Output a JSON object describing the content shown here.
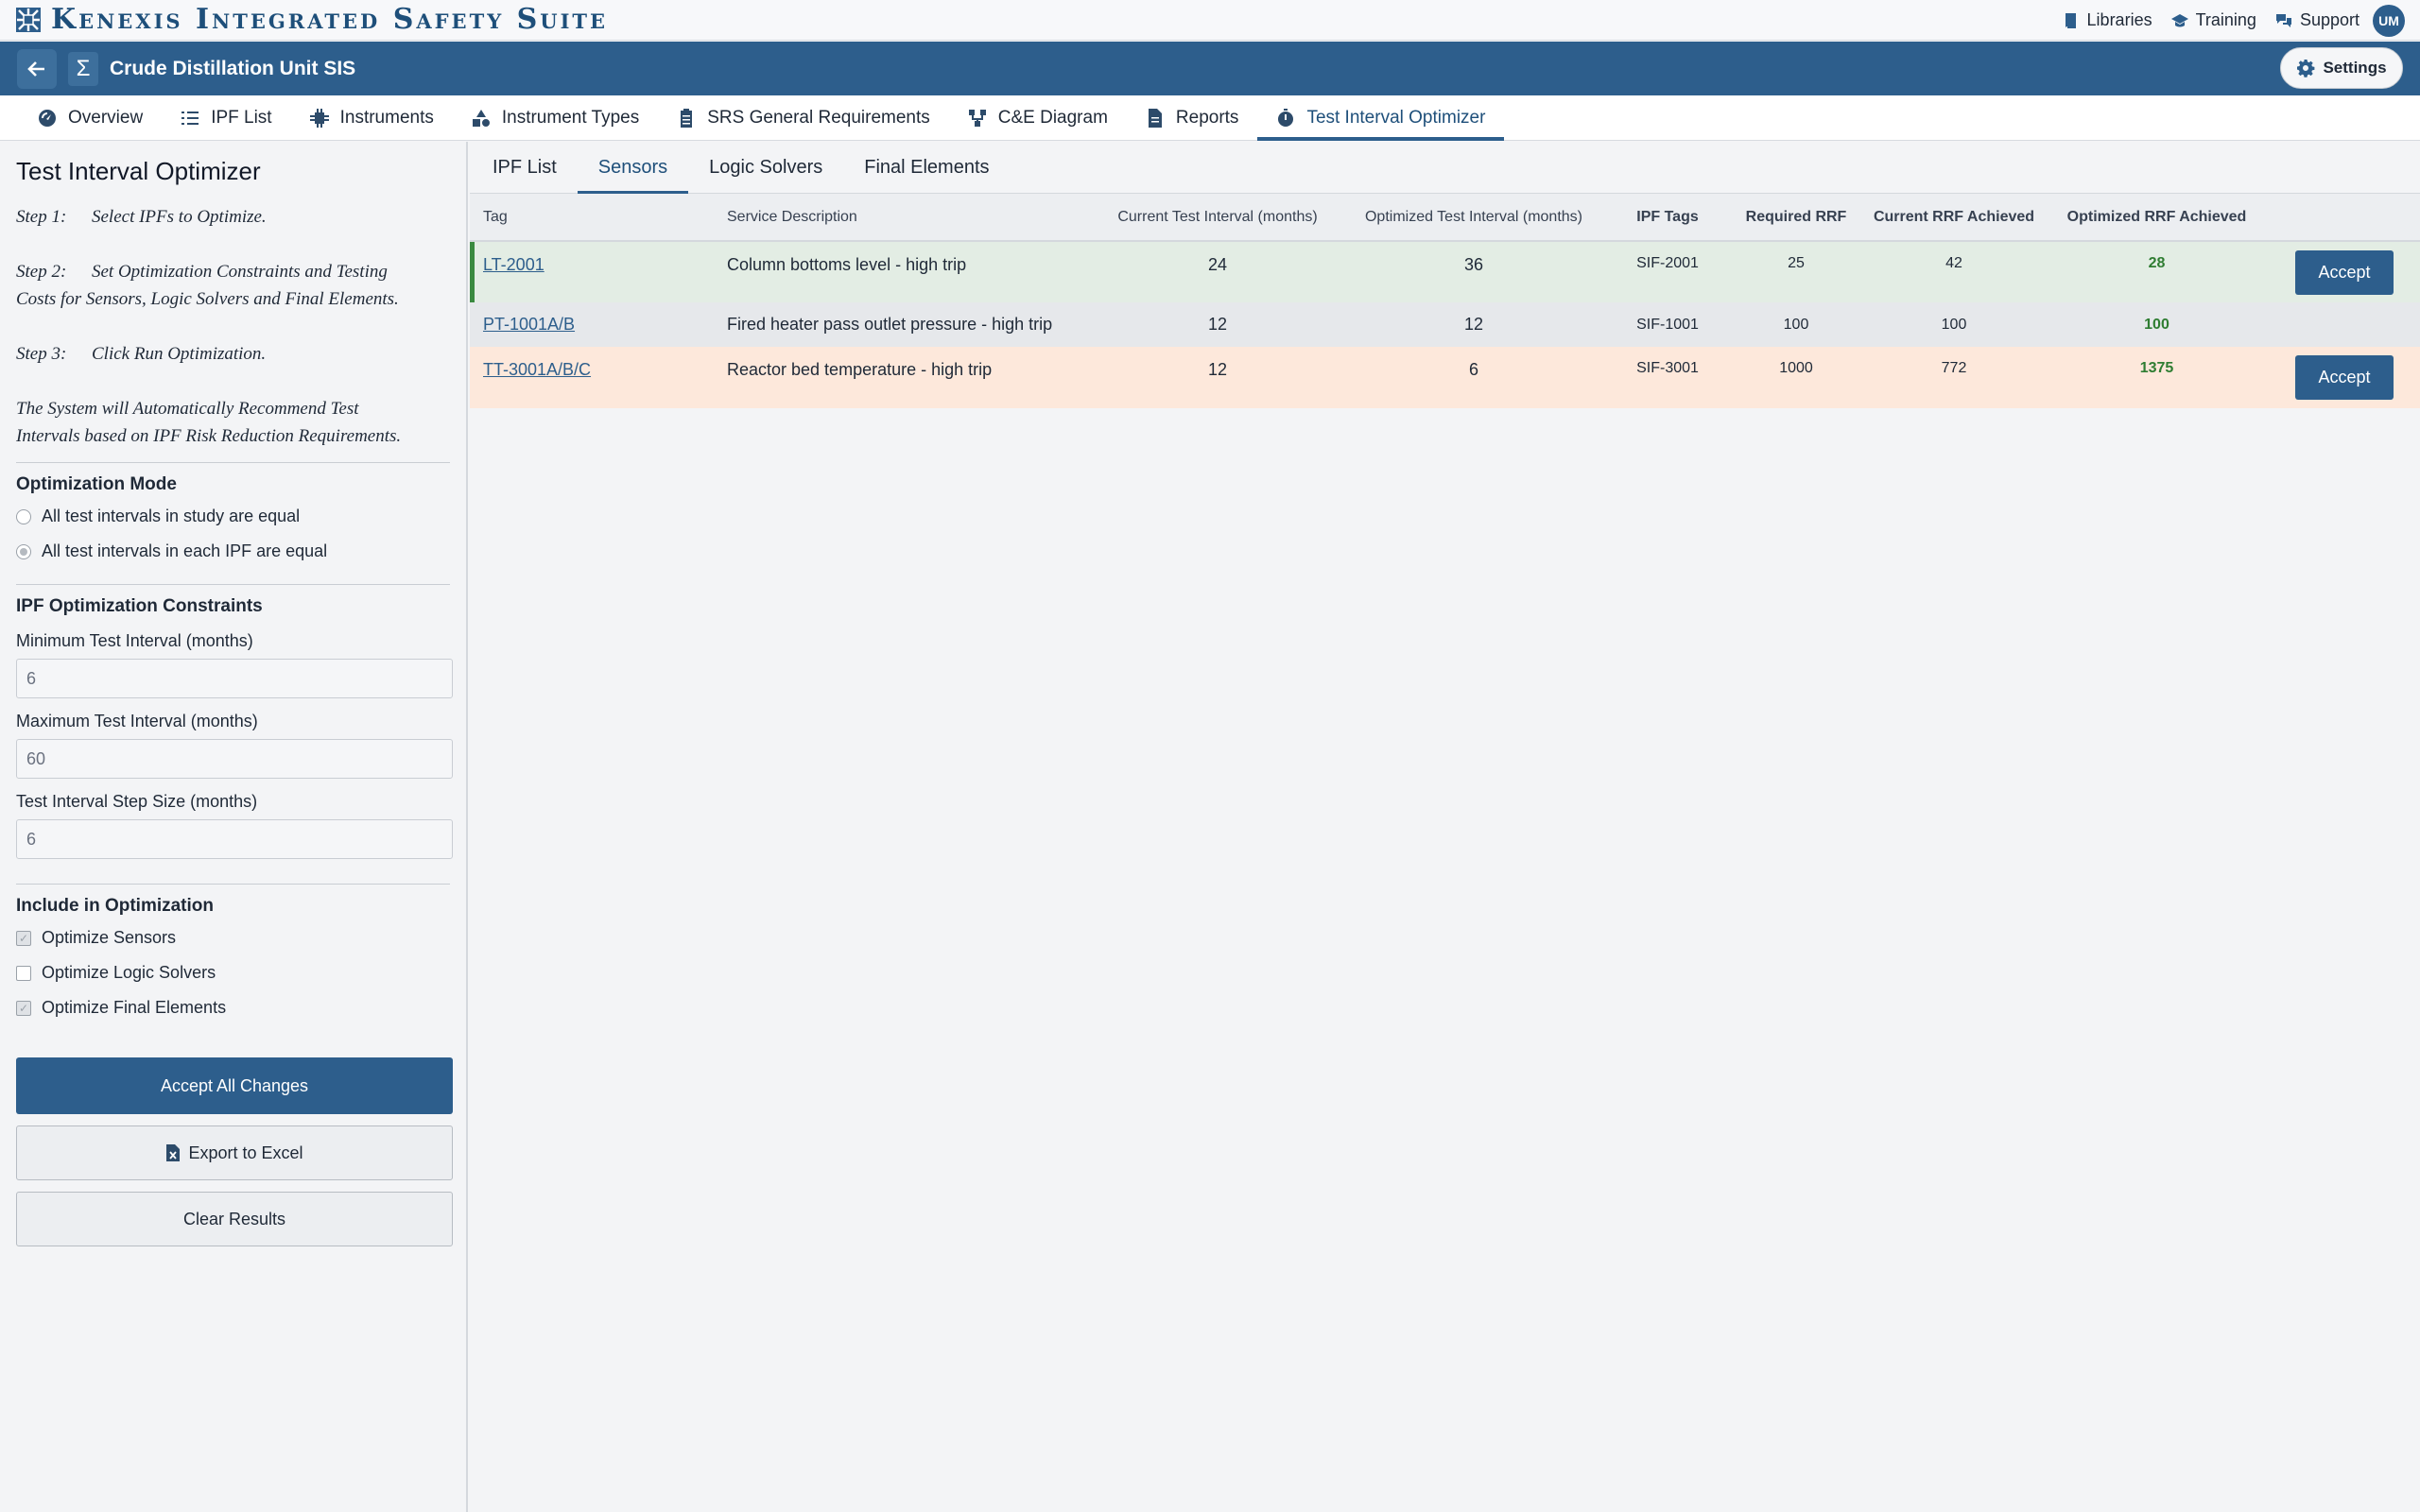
{
  "app": {
    "title": "Kenexis Integrated Safety Suite",
    "links": [
      {
        "label": "Libraries",
        "icon": "book-icon"
      },
      {
        "label": "Training",
        "icon": "graduation-cap-icon"
      },
      {
        "label": "Support",
        "icon": "chat-bubbles-icon"
      }
    ],
    "user_initials": "UM"
  },
  "project": {
    "title": "Crude Distillation Unit SIS",
    "settings_label": "Settings",
    "sigma": "Σ"
  },
  "main_tabs": [
    {
      "label": "Overview",
      "icon": "gauge-icon"
    },
    {
      "label": "IPF List",
      "icon": "list-icon"
    },
    {
      "label": "Instruments",
      "icon": "chip-icon"
    },
    {
      "label": "Instrument Types",
      "icon": "shapes-icon"
    },
    {
      "label": "SRS General Requirements",
      "icon": "clipboard-icon"
    },
    {
      "label": "C&E Diagram",
      "icon": "diagram-icon"
    },
    {
      "label": "Reports",
      "icon": "file-icon"
    },
    {
      "label": "Test Interval Optimizer",
      "icon": "stopwatch-icon",
      "active": true
    }
  ],
  "left": {
    "title": "Test Interval Optimizer",
    "steps": [
      {
        "num": "Step 1:",
        "text": "Select IPFs to Optimize."
      },
      {
        "num": "Step 2:",
        "text": "Set Optimization Constraints and Testing",
        "text2": "Costs for Sensors, Logic Solvers and Final Elements."
      },
      {
        "num": "Step 3:",
        "text": "Click Run Optimization."
      }
    ],
    "note_line1": "The System will Automatically Recommend Test",
    "note_line2": "Intervals based on IPF Risk Reduction Requirements.",
    "mode": {
      "heading": "Optimization Mode",
      "options": [
        "All test intervals in study are equal",
        "All test intervals in each IPF are equal"
      ],
      "selected_index": 1
    },
    "constraints": {
      "heading": "IPF Optimization Constraints",
      "min_label": "Minimum Test Interval (months)",
      "min_value": "6",
      "max_label": "Maximum Test Interval (months)",
      "max_value": "60",
      "step_label": "Test Interval Step Size (months)",
      "step_value": "6"
    },
    "include": {
      "heading": "Include in Optimization",
      "items": [
        {
          "label": "Optimize Sensors",
          "checked": true
        },
        {
          "label": "Optimize Logic Solvers",
          "checked": false
        },
        {
          "label": "Optimize Final Elements",
          "checked": true
        }
      ]
    },
    "buttons": {
      "accept_all": "Accept All Changes",
      "export": "Export to Excel",
      "clear": "Clear Results"
    }
  },
  "sub_tabs": [
    {
      "label": "IPF List"
    },
    {
      "label": "Sensors",
      "active": true
    },
    {
      "label": "Logic Solvers"
    },
    {
      "label": "Final Elements"
    }
  ],
  "table": {
    "headers": [
      "Tag",
      "Service Description",
      "Current Test Interval (months)",
      "Optimized Test Interval (months)",
      "IPF Tags",
      "Required RRF",
      "Current RRF Achieved",
      "Optimized RRF Achieved"
    ],
    "rows": [
      {
        "tag": "LT-2001",
        "desc": "Column bottoms level - high trip",
        "current": "24",
        "optimized": "36",
        "ipf": "SIF-2001",
        "required": "25",
        "current_rrf": "42",
        "optimized_rrf": "28",
        "action": "Accept",
        "status": "changed-increase"
      },
      {
        "tag": "PT-1001A/B",
        "desc": "Fired heater pass outlet pressure - high trip",
        "current": "12",
        "optimized": "12",
        "ipf": "SIF-1001",
        "required": "100",
        "current_rrf": "100",
        "optimized_rrf": "100",
        "action": "",
        "status": "unchanged"
      },
      {
        "tag": "TT-3001A/B/C",
        "desc": "Reactor bed temperature - high trip",
        "current": "12",
        "optimized": "6",
        "ipf": "SIF-3001",
        "required": "1000",
        "current_rrf": "772",
        "optimized_rrf": "1375",
        "action": "Accept",
        "status": "changed-decrease"
      }
    ]
  },
  "colors": {
    "primary": "#2d5e8c",
    "brand_text": "#1e4f7a",
    "row_increase": "#e3ede4",
    "row_decrease": "#fde8db",
    "optimized_value": "#2f7d32"
  }
}
